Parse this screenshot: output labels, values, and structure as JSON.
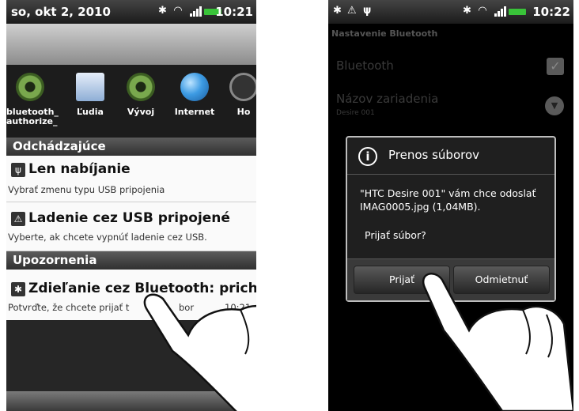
{
  "left": {
    "status": {
      "date": "so, okt 2, 2010",
      "time": "10:21"
    },
    "apps": [
      {
        "label1": "bluetooth_",
        "label2": "authorize_",
        "icon": "gear-icon"
      },
      {
        "label1": "Ľudia",
        "label2": "",
        "icon": "contacts-icon"
      },
      {
        "label1": "Vývoj",
        "label2": "",
        "icon": "gear-icon"
      },
      {
        "label1": "Internet",
        "label2": "",
        "icon": "globe-icon"
      },
      {
        "label1": "Ho",
        "label2": "",
        "icon": "clock-icon"
      }
    ],
    "ongoing_header": "Odchádzajúce",
    "ongoing": [
      {
        "title": "Len nabíjanie",
        "sub": "Vybrať zmenu typu USB pripojenia",
        "icon": "usb-icon"
      },
      {
        "title": "Ladenie cez USB pripojené",
        "sub": "Vyberte, ak chcete vypnúť ladenie cez USB.",
        "icon": "warning-icon"
      }
    ],
    "notif_header": "Upozornenia",
    "notif": {
      "title": "Zdieľanie cez Bluetooth: prichádz",
      "sub": "Potvrďte, že chcete prijať t",
      "sub2": "bor",
      "time": "10:21",
      "icon": "bluetooth-icon"
    }
  },
  "right": {
    "status": {
      "time": "10:22"
    },
    "screen_title": "Nastavenie Bluetooth",
    "bg_items": {
      "bluetooth": "Bluetooth",
      "device_name": "Názov zariadenia",
      "device_sub": "Desire 001"
    },
    "dialog": {
      "title": "Prenos súborov",
      "message": "\"HTC Desire 001\" vám chce odoslať IMAG0005.jpg (1,04MB).",
      "question": "Prijať súbor?",
      "accept": "Prijať",
      "decline": "Odmietnuť"
    }
  }
}
